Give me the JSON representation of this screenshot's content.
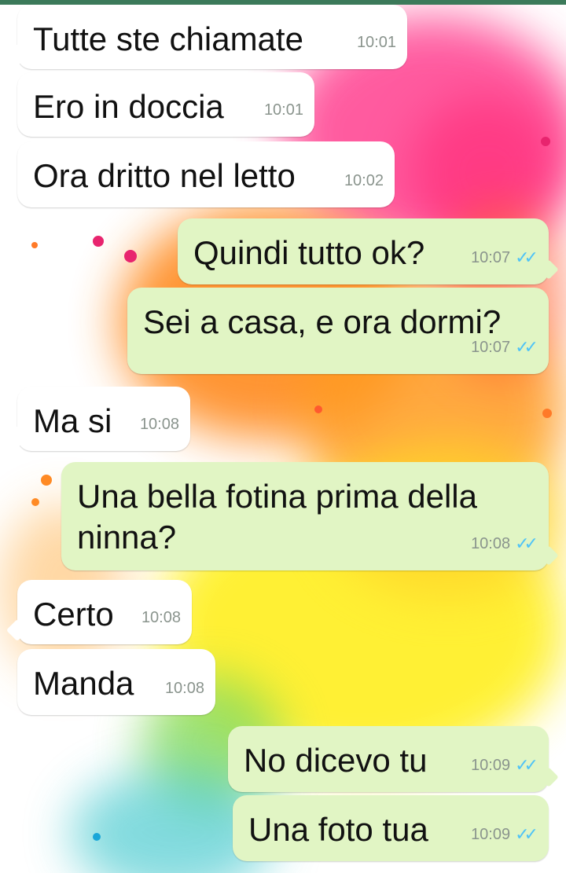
{
  "colors": {
    "incoming_bubble": "#ffffff",
    "outgoing_bubble": "#e1f5c4",
    "timestamp": "#8a948d",
    "read_ticks": "#4fc3f7"
  },
  "messages": [
    {
      "text": "Tutte ste chiamate",
      "time": "10:01",
      "direction": "in"
    },
    {
      "text": "Ero in doccia",
      "time": "10:01",
      "direction": "in"
    },
    {
      "text": "Ora dritto nel letto",
      "time": "10:02",
      "direction": "in"
    },
    {
      "text": "Quindi tutto ok?",
      "time": "10:07",
      "direction": "out",
      "ticks": "✓✓"
    },
    {
      "text": "Sei a casa, e ora dormi?",
      "time": "10:07",
      "direction": "out",
      "ticks": "✓✓"
    },
    {
      "text": "Ma si",
      "time": "10:08",
      "direction": "in"
    },
    {
      "text": "Una bella fotina prima della ninna?",
      "time": "10:08",
      "direction": "out",
      "ticks": "✓✓"
    },
    {
      "text": "Certo",
      "time": "10:08",
      "direction": "in"
    },
    {
      "text": "Manda",
      "time": "10:08",
      "direction": "in"
    },
    {
      "text": "No dicevo tu",
      "time": "10:09",
      "direction": "out",
      "ticks": "✓✓"
    },
    {
      "text": "Una foto tua",
      "time": "10:09",
      "direction": "out",
      "ticks": "✓✓"
    }
  ]
}
